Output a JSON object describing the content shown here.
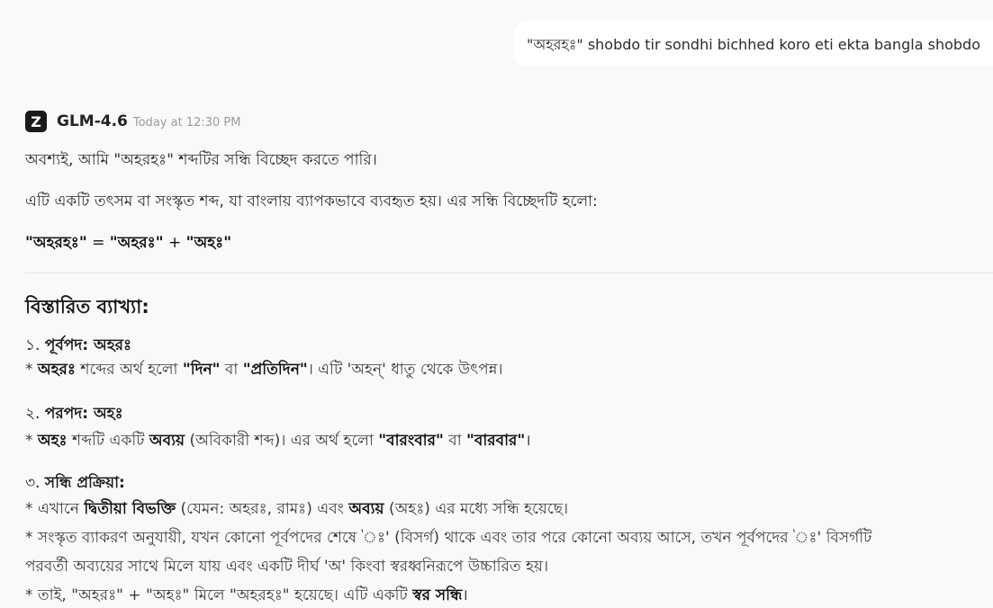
{
  "user_message": "\"অহরহঃ\" shobdo tir sondhi bichhed koro eti ekta bangla shobdo",
  "assistant": {
    "logo_letter": "Z",
    "model_name": "GLM-4.6",
    "timestamp": "Today at 12:30 PM",
    "intro": "অবশ্যই, আমি \"অহরহঃ\" শব্দটির সন্ধি বিচ্ছেদ করতে পারি।",
    "description": "এটি একটি তৎসম বা সংস্কৃত শব্দ, যা বাংলায় ব্যাপকভাবে ব্যবহৃত হয়। এর সন্ধি বিচ্ছেদটি হলো:",
    "equation": {
      "word": "\"অহরহঃ\"",
      "eq_sign": " = ",
      "part1": "\"অহরঃ\"",
      "plus": " + ",
      "part2": "\"অহঃ\""
    },
    "detail_heading": "বিস্তারিত ব্যাখ্যা:",
    "sections": [
      {
        "number": "১.",
        "title": "পূর্বপদ: অহরঃ",
        "lines": [
          {
            "bullet": "* ",
            "b1": "অহরঃ",
            "t1": " শব্দের অর্থ হলো ",
            "b2": "\"দিন\"",
            "t2": " বা ",
            "b3": "\"প্রতিদিন\"",
            "t3": "। এটি 'অহন্' ধাতু থেকে উৎপন্ন।"
          }
        ]
      },
      {
        "number": "২.",
        "title": "পরপদ: অহঃ",
        "lines": [
          {
            "bullet": "* ",
            "b1": "অহঃ",
            "t1": " শব্দটি একটি ",
            "b2": "অব্যয়",
            "t2": " (অবিকারী শব্দ)। এর অর্থ হলো ",
            "b3": "\"বারংবার\"",
            "t3": " বা ",
            "b4": "\"বারবার\"",
            "t4": "।"
          }
        ]
      },
      {
        "number": "৩.",
        "title": "সন্ধি প্রক্রিয়া:",
        "line1": {
          "t0": "* এখানে ",
          "b1": "দ্বিতীয়া বিভক্তি",
          "t1": " (যেমন: অহরঃ, রামঃ) এবং ",
          "b2": "অব্যয়",
          "t2": " (অহঃ) এর মধ্যে সন্ধি হয়েছে।"
        },
        "line2a": "* সংস্কৃত ব্যাকরণ অনুযায়ী, যখন কোনো পূর্বপদের শেষে 'ঃ' (বিসর্গ) থাকে এবং তার পরে কোনো অব্যয় আসে, তখন পূর্বপদের 'ঃ' বিসর্গটি",
        "line2b": "পরবর্তী অব্যয়ের সাথে মিলে যায় এবং একটি দীর্ঘ 'অ' কিংবা স্বরধ্বনিরূপে উচ্চারিত হয়।",
        "line3": {
          "t0": "* তাই, \"অহরঃ\" + \"অহঃ\" মিলে \"অহরহঃ\" হয়েছে। এটি একটি ",
          "b1": "স্বর সন্ধি",
          "t1": "।"
        }
      }
    ]
  }
}
